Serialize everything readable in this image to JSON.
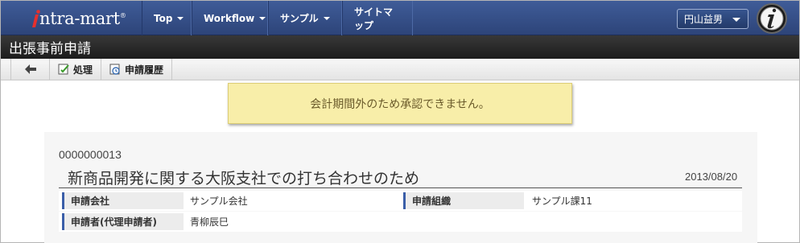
{
  "app": {
    "logo_text": "ntra-mart",
    "logo_reg": "®",
    "user_name": "円山益男"
  },
  "nav": {
    "items": [
      {
        "label": "Top",
        "has_caret": true
      },
      {
        "label": "Workflow",
        "has_caret": true
      },
      {
        "label": "サンプル",
        "has_caret": true
      },
      {
        "label": "サイトマップ",
        "has_caret": false
      }
    ]
  },
  "page": {
    "title": "出張事前申請"
  },
  "toolbar": {
    "back_icon": "arrow-left-icon",
    "process_label": "処理",
    "history_label": "申請履歴"
  },
  "message": {
    "text": "会計期間外のため承認できません。"
  },
  "document": {
    "number": "0000000013",
    "title": "新商品開発に関する大阪支社での打ち合わせのため",
    "date": "2013/08/20",
    "fields": [
      {
        "label": "申請会社",
        "value": "サンプル会社"
      },
      {
        "label": "申請組織",
        "value": "サンプル課11"
      },
      {
        "label": "申請者(代理申請者)",
        "value": "青柳辰巳"
      }
    ]
  },
  "colors": {
    "navbar": "#2d4479",
    "titlebar": "#2a2a2a",
    "message_bg": "#f8eea9",
    "label_accent": "#3a5ea8"
  }
}
